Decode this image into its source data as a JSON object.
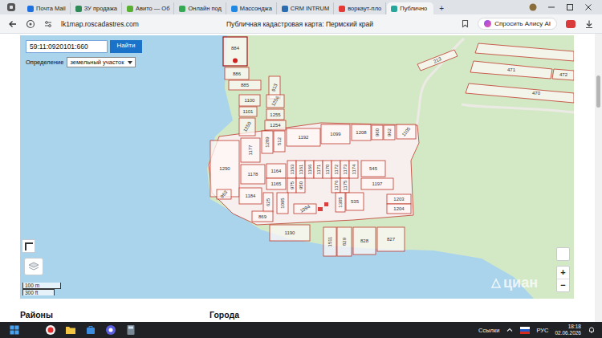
{
  "browser": {
    "tabs": [
      {
        "label": "Почта Mail",
        "color": "#1e6fe0",
        "selected": false
      },
      {
        "label": "ЗУ продажа",
        "color": "#2e8b57",
        "selected": false
      },
      {
        "label": "Авито — Об",
        "color": "#58b030",
        "selected": false
      },
      {
        "label": "Онлайн под",
        "color": "#34a853",
        "selected": false
      },
      {
        "label": "Массонджа",
        "color": "#1e88e5",
        "selected": false
      },
      {
        "label": "CRM INTRUM",
        "color": "#2b6cb0",
        "selected": false
      },
      {
        "label": "воркаут-пло",
        "color": "#e53935",
        "selected": false
      },
      {
        "label": "Публично",
        "color": "#26a69a",
        "selected": true
      }
    ],
    "new_tab": "+"
  },
  "address_bar": {
    "url": "lk1map.roscadastres.com",
    "page_title": "Публичная кадастровая карта: Пермский край",
    "assistant": "Спросить Алису AI"
  },
  "map": {
    "search": {
      "value": "59:11:0920101:660",
      "button": "Найти"
    },
    "definition": {
      "label": "Определение",
      "value": "земельный участок"
    },
    "parcels": [
      {
        "label": "884",
        "selected": true
      },
      {
        "label": "886",
        "selected": false
      },
      {
        "label": "885",
        "selected": false
      },
      {
        "label": "913",
        "selected": false
      },
      {
        "label": "1100",
        "selected": false
      },
      {
        "label": "1101",
        "selected": false
      },
      {
        "label": "1256",
        "selected": false
      },
      {
        "label": "1255",
        "selected": false
      },
      {
        "label": "1250",
        "selected": false
      },
      {
        "label": "1254",
        "selected": false
      },
      {
        "label": "1177",
        "selected": false
      },
      {
        "label": "1289",
        "selected": false
      },
      {
        "label": "512",
        "selected": false
      },
      {
        "label": "1192",
        "selected": false
      },
      {
        "label": "1099",
        "selected": false
      },
      {
        "label": "1208",
        "selected": false
      },
      {
        "label": "960",
        "selected": false
      },
      {
        "label": "962",
        "selected": false
      },
      {
        "label": "1105",
        "selected": false
      },
      {
        "label": "1290",
        "selected": false
      },
      {
        "label": "1178",
        "selected": false
      },
      {
        "label": "1164",
        "selected": false
      },
      {
        "label": "1165",
        "selected": false
      },
      {
        "label": "1163",
        "selected": false
      },
      {
        "label": "1161",
        "selected": false
      },
      {
        "label": "1166",
        "selected": false
      },
      {
        "label": "1171",
        "selected": false
      },
      {
        "label": "1170",
        "selected": false
      },
      {
        "label": "1172",
        "selected": false
      },
      {
        "label": "1173",
        "selected": false
      },
      {
        "label": "1174",
        "selected": false
      },
      {
        "label": "975",
        "selected": false
      },
      {
        "label": "950",
        "selected": false
      },
      {
        "label": "1176",
        "selected": false
      },
      {
        "label": "1175",
        "selected": false
      },
      {
        "label": "545",
        "selected": false
      },
      {
        "label": "1197",
        "selected": false
      },
      {
        "label": "1184",
        "selected": false
      },
      {
        "label": "963",
        "selected": false
      },
      {
        "label": "625",
        "selected": false
      },
      {
        "label": "1095",
        "selected": false
      },
      {
        "label": "1094",
        "selected": false
      },
      {
        "label": "1305",
        "selected": false
      },
      {
        "label": "535",
        "selected": false
      },
      {
        "label": "1203",
        "selected": false
      },
      {
        "label": "1204",
        "selected": false
      },
      {
        "label": "869",
        "selected": false
      },
      {
        "label": "1190",
        "selected": false
      },
      {
        "label": "1511",
        "selected": false
      },
      {
        "label": "829",
        "selected": false
      },
      {
        "label": "828",
        "selected": false
      },
      {
        "label": "827",
        "selected": false
      },
      {
        "label": "213",
        "selected": false
      },
      {
        "label": "471",
        "selected": false
      },
      {
        "label": "472",
        "selected": false
      },
      {
        "label": "470",
        "selected": false
      }
    ],
    "scale": {
      "metric": "100 m",
      "imperial": "300 ft"
    },
    "zoom": {
      "in": "+",
      "out": "−"
    },
    "watermark": "циан"
  },
  "sections": [
    "Районы",
    "Города"
  ],
  "taskbar": {
    "links": "Ссылки",
    "language": "РУС",
    "time": "18:18",
    "date": "02.06.2026"
  }
}
